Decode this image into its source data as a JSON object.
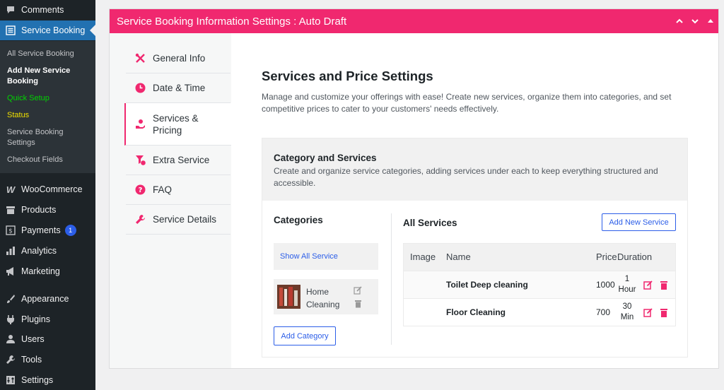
{
  "sidebar": {
    "items": [
      {
        "label": "Comments",
        "icon": "comment-icon"
      },
      {
        "label": "Service Booking",
        "icon": "list-icon"
      },
      {
        "label": "WooCommerce",
        "icon": "woocommerce-icon"
      },
      {
        "label": "Products",
        "icon": "archive-icon"
      },
      {
        "label": "Payments",
        "icon": "dollar-icon",
        "badge": "1"
      },
      {
        "label": "Analytics",
        "icon": "bar-chart-icon"
      },
      {
        "label": "Marketing",
        "icon": "megaphone-icon"
      },
      {
        "label": "Appearance",
        "icon": "brush-icon"
      },
      {
        "label": "Plugins",
        "icon": "plug-icon"
      },
      {
        "label": "Users",
        "icon": "user-icon"
      },
      {
        "label": "Tools",
        "icon": "wrench-icon"
      },
      {
        "label": "Settings",
        "icon": "sliders-icon"
      }
    ],
    "submenu": [
      {
        "label": "All Service Booking",
        "color": "#c3c4c7"
      },
      {
        "label": "Add New Service Booking",
        "color": "#ffffff"
      },
      {
        "label": "Quick Setup",
        "color": "#00d400"
      },
      {
        "label": "Status",
        "color": "#f0e000"
      },
      {
        "label": "Service Booking Settings",
        "color": "#c3c4c7"
      },
      {
        "label": "Checkout Fields",
        "color": "#c3c4c7"
      }
    ]
  },
  "metabox": {
    "title": "Service Booking Information Settings : Auto Draft",
    "accent": "#f0286f",
    "controls": [
      "chevron-up-icon",
      "chevron-down-icon",
      "triangle-up-icon"
    ]
  },
  "tabs": [
    {
      "label": "General Info",
      "icon": "tools-icon"
    },
    {
      "label": "Date & Time",
      "icon": "clock-icon"
    },
    {
      "label": "Services & Pricing",
      "icon": "hand-coin-icon",
      "active": true
    },
    {
      "label": "Extra Service",
      "icon": "filter-dollar-icon"
    },
    {
      "label": "FAQ",
      "icon": "question-icon"
    },
    {
      "label": "Service Details",
      "icon": "wrench-icon"
    }
  ],
  "content": {
    "title": "Services and Price Settings",
    "description": "Manage and customize your offerings with ease! Create new services, organize them into categories, and set competitive prices to cater to your customers' needs effectively."
  },
  "category_panel": {
    "title": "Category and Services",
    "description": "Create and organize service categories, adding services under each to keep everything structured and accessible.",
    "categories_title": "Categories",
    "show_all": "Show All Service",
    "category": {
      "name": "Home Cleaning"
    },
    "add_category": "Add Category",
    "all_services_title": "All Services",
    "add_new_service": "Add New Service",
    "table": {
      "headers": [
        "Image",
        "Name",
        "Price",
        "Duration"
      ],
      "rows": [
        {
          "name": "Toilet Deep cleaning",
          "price": "1000",
          "duration": "1 Hour"
        },
        {
          "name": "Floor Cleaning",
          "price": "700",
          "duration": "30 Min"
        }
      ]
    }
  }
}
